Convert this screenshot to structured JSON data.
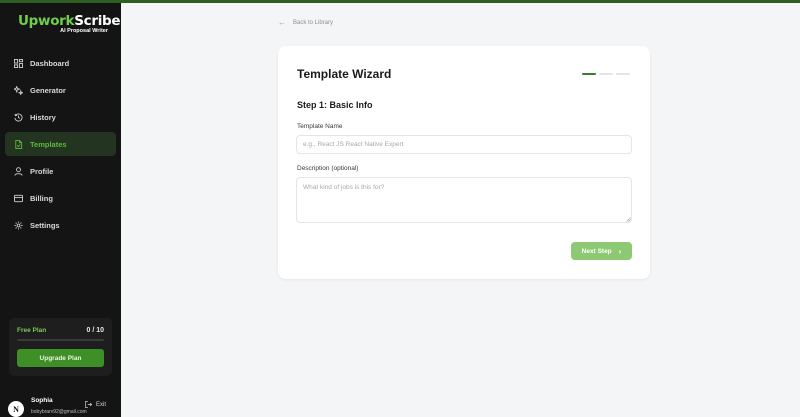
{
  "brand": {
    "logo_part1": "Upwork",
    "logo_part2": "Scribe",
    "tagline": "AI Proposal Writer",
    "accent_color": "#5fb83c",
    "sidebar_bg": "#141414"
  },
  "sidebar": {
    "items": [
      {
        "label": "Dashboard",
        "icon": "grid-icon",
        "active": false
      },
      {
        "label": "Generator",
        "icon": "sparkle-icon",
        "active": false
      },
      {
        "label": "History",
        "icon": "history-icon",
        "active": false
      },
      {
        "label": "Templates",
        "icon": "file-icon",
        "active": true
      },
      {
        "label": "Profile",
        "icon": "user-icon",
        "active": false
      },
      {
        "label": "Billing",
        "icon": "card-icon",
        "active": false
      },
      {
        "label": "Settings",
        "icon": "gear-icon",
        "active": false
      }
    ],
    "plan": {
      "name": "Free Plan",
      "count": "0 / 10",
      "usage_fraction": 0,
      "upgrade_label": "Upgrade Plan"
    },
    "user": {
      "initial": "N",
      "name": "Sophia",
      "email": "bobybrarv92@gmail.com",
      "exit_label": "Exit"
    }
  },
  "main": {
    "back_label": "Back to Library",
    "wizard": {
      "title": "Template Wizard",
      "steps_total": 3,
      "current_step": 1,
      "step_heading": "Step 1: Basic Info",
      "name_label": "Template Name",
      "name_placeholder": "e.g., React JS React Native Expert",
      "name_value": "",
      "desc_label": "Description (optional)",
      "desc_placeholder": "What kind of jobs is this for?",
      "desc_value": "",
      "next_label": "Next Step"
    }
  }
}
